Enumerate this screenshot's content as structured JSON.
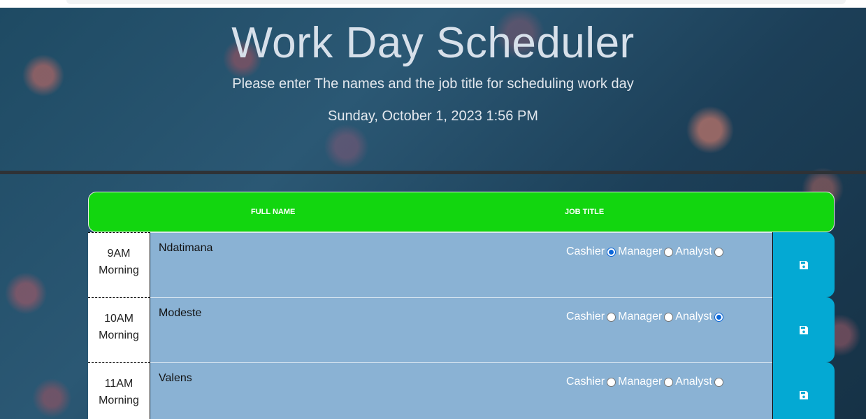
{
  "header": {
    "title": "Work Day Scheduler",
    "subtitle": "Please enter The names and the job title for scheduling work day",
    "datetime": "Sunday, October 1, 2023 1:56 PM"
  },
  "table_header": {
    "full_name": "FULL NAME",
    "job_title": "JOB TITLE"
  },
  "colors": {
    "header_bar": "#12d60f",
    "row_background": "#8ab2d4",
    "save_button": "#04a9d3",
    "radio_selected": "#0b66d8"
  },
  "job_options": [
    "Cashier",
    "Manager",
    "Analyst"
  ],
  "rows": [
    {
      "hour": "9AM",
      "period": "Morning",
      "name": "Ndatimana",
      "selected": "Cashier",
      "save_icon": "floppy-disk-icon"
    },
    {
      "hour": "10AM",
      "period": "Morning",
      "name": "Modeste",
      "selected": "Analyst",
      "save_icon": "floppy-disk-icon"
    },
    {
      "hour": "11AM",
      "period": "Morning",
      "name": "Valens",
      "selected": "",
      "save_icon": "floppy-disk-icon"
    }
  ]
}
